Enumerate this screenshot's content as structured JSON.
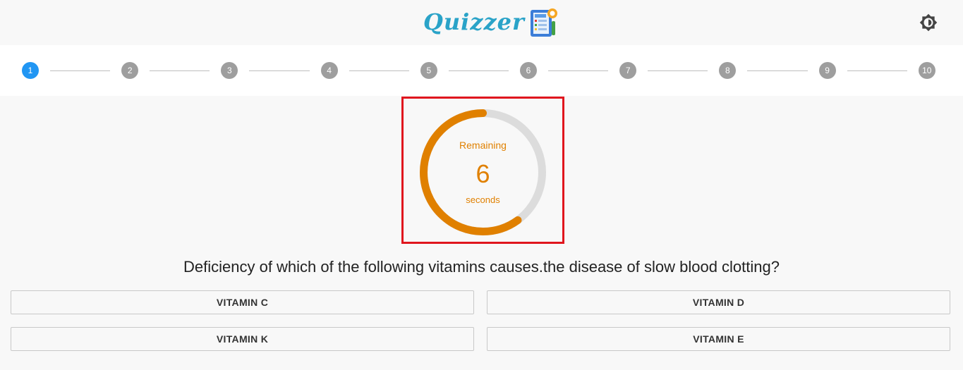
{
  "header": {
    "logo_text": "Quizzer",
    "logo_icon": "quiz-document-icon",
    "theme_toggle_icon": "brightness-icon"
  },
  "stepper": {
    "steps": [
      "1",
      "2",
      "3",
      "4",
      "5",
      "6",
      "7",
      "8",
      "9",
      "10"
    ],
    "active_step": "1"
  },
  "timer": {
    "label_top": "Remaining",
    "value": "6",
    "unit": "seconds",
    "progress_fraction": 0.6,
    "color": "#e08000"
  },
  "question": {
    "text": "Deficiency of which of the following vitamins causes.the disease of slow blood clotting?"
  },
  "answers": [
    {
      "label": "VITAMIN C"
    },
    {
      "label": "VITAMIN D"
    },
    {
      "label": "VITAMIN K"
    },
    {
      "label": "VITAMIN E"
    }
  ],
  "colors": {
    "accent": "#2196f3",
    "timer": "#e08000",
    "highlight_border": "#e0161e"
  }
}
